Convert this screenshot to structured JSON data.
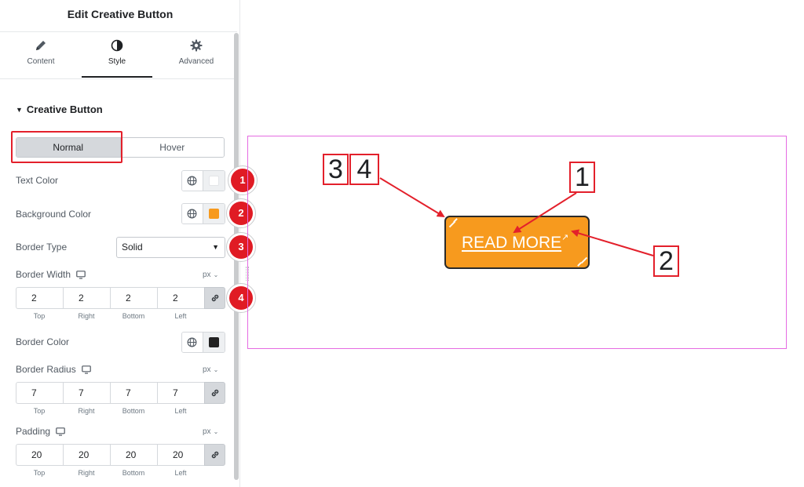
{
  "panel": {
    "title": "Edit Creative Button",
    "tabs": [
      {
        "label": "Content",
        "icon": "pencil-icon"
      },
      {
        "label": "Style",
        "icon": "contrast-icon"
      },
      {
        "label": "Advanced",
        "icon": "gear-icon"
      }
    ],
    "active_tab": "Style",
    "section": "Creative Button",
    "state_switch": {
      "normal": "Normal",
      "hover": "Hover",
      "selected": "Normal"
    },
    "controls": {
      "text_color": {
        "label": "Text Color",
        "value": "#ffffff"
      },
      "background_color": {
        "label": "Background Color",
        "value": "#f79a1e"
      },
      "border_type": {
        "label": "Border Type",
        "value": "Solid"
      },
      "border_width": {
        "label": "Border Width",
        "unit": "px",
        "top": "2",
        "right": "2",
        "bottom": "2",
        "left": "2"
      },
      "border_color": {
        "label": "Border Color",
        "value": "#222222"
      },
      "border_radius": {
        "label": "Border Radius",
        "unit": "px",
        "top": "7",
        "right": "7",
        "bottom": "7",
        "left": "7"
      },
      "padding": {
        "label": "Padding",
        "unit": "px",
        "top": "20",
        "right": "20",
        "bottom": "20",
        "left": "20"
      }
    },
    "side_labels": {
      "top": "Top",
      "right": "Right",
      "bottom": "Bottom",
      "left": "Left"
    },
    "markers": [
      "1",
      "2",
      "3",
      "4"
    ]
  },
  "preview": {
    "button_text": "READ MORE",
    "button_color": "#f79a1e",
    "callouts": {
      "one": "1",
      "two": "2",
      "three": "3",
      "four": "4"
    }
  },
  "colors": {
    "accent_red": "#e3202b",
    "marker_red": "#e01b24",
    "frame_pink": "#e56be2"
  }
}
